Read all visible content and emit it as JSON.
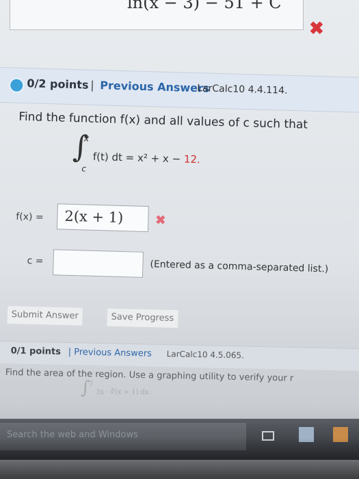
{
  "previous_answer": {
    "text": "ln(x − 3) − 51 + C",
    "mark": "✖"
  },
  "question1": {
    "points": "0/2 points",
    "separator": "|",
    "previous_answers": "Previous Answers",
    "reference": "LarCalc10 4.4.114.",
    "prompt": "Find the function f(x) and all values of c such that",
    "integral": {
      "upper": "x",
      "lower": "c",
      "integrand": "f(t) dt = x² + x − ",
      "constant": "12."
    },
    "fx_label": "f(x) =",
    "fx_value": "2(x + 1)",
    "fx_mark": "✖",
    "c_label": "c =",
    "c_value": "",
    "c_hint": "(Entered as a comma-separated list.)"
  },
  "buttons": {
    "submit": "Submit Answer",
    "save": "Save Progress"
  },
  "question2": {
    "points": "0/1 points",
    "previous_answers": "| Previous Answers",
    "reference": "LarCalc10 4.5.065.",
    "prompt": "Find the area of the region. Use a graphing utility to verify your r",
    "integral_sup": "7",
    "integral_text": "3x · ∛(x + 1) dx"
  },
  "taskbar": {
    "search_placeholder": "Search the web and Windows"
  },
  "colors": {
    "error_red": "#d8363c",
    "link_blue": "#2a64a8",
    "header_bg": "#dfe7f2"
  }
}
